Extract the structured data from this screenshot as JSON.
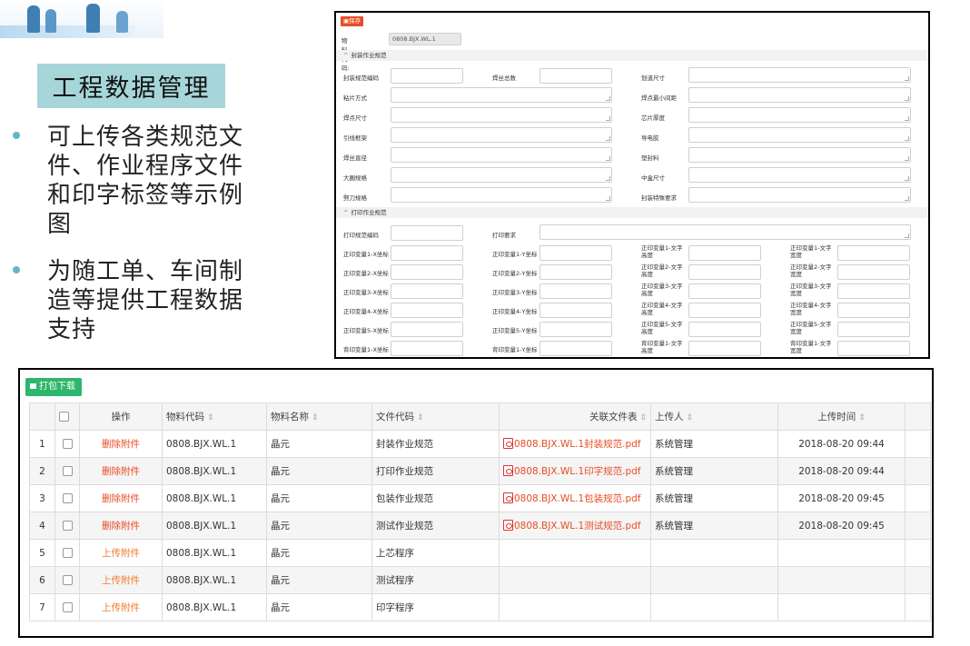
{
  "slide": {
    "title": "工程数据管理",
    "bullets": [
      "可上传各类规范文件、作业程序文件和印字标签等示例图",
      "为随工单、车间制造等提供工程数据支持"
    ]
  },
  "form": {
    "save_label": "保存",
    "material_code_label": "物料代码:",
    "material_code_value": "0808.BJX.WL.1",
    "sections": [
      {
        "title": "封装作业规范",
        "fields": [
          "封装规范编码",
          "焊丝总数",
          "划道尺寸",
          "粘片方式",
          "焊点最小间距",
          "焊点尺寸",
          "芯片厚度",
          "引线框架",
          "导电胶",
          "焊丝直径",
          "塑封料",
          "大圈规格",
          "中盒尺寸",
          "劈刀规格",
          "封装特殊要求"
        ]
      },
      {
        "title": "打印作业规范",
        "fields": [
          "打印规范编码",
          "打印要求",
          "正印变量1-X坐标",
          "正印变量1-Y坐标",
          "正印变量1-文字高度",
          "正印变量1-文字宽度",
          "正印变量2-X坐标",
          "正印变量2-Y坐标",
          "正印变量2-文字高度",
          "正印变量2-文字宽度",
          "正印变量3-X坐标",
          "正印变量3-Y坐标",
          "正印变量3-文字高度",
          "正印变量3-文字宽度",
          "正印变量4-X坐标",
          "正印变量4-Y坐标",
          "正印变量4-文字高度",
          "正印变量4-文字宽度",
          "正印变量5-X坐标",
          "正印变量5-Y坐标",
          "正印变量5-文字高度",
          "正印变量5-文字宽度",
          "背印变量1-X坐标",
          "背印变量1-Y坐标",
          "背印变量1-文字高度",
          "背印变量1-文字宽度"
        ]
      }
    ]
  },
  "table": {
    "pack_download_label": "打包下载",
    "columns": [
      "操作",
      "物料代码",
      "物料名称",
      "文件代码",
      "关联文件表",
      "上传人",
      "上传时间"
    ],
    "rows": [
      {
        "num": "1",
        "op": "删除附件",
        "code": "0808.BJX.WL.1",
        "name": "晶元",
        "file": "封装作业规范",
        "rel": "0808.BJX.WL.1封装规范.pdf",
        "uploader": "系统管理",
        "time": "2018-08-20 09:44"
      },
      {
        "num": "2",
        "op": "删除附件",
        "code": "0808.BJX.WL.1",
        "name": "晶元",
        "file": "打印作业规范",
        "rel": "0808.BJX.WL.1印字规范.pdf",
        "uploader": "系统管理",
        "time": "2018-08-20 09:44"
      },
      {
        "num": "3",
        "op": "删除附件",
        "code": "0808.BJX.WL.1",
        "name": "晶元",
        "file": "包装作业规范",
        "rel": "0808.BJX.WL.1包装规范.pdf",
        "uploader": "系统管理",
        "time": "2018-08-20 09:45"
      },
      {
        "num": "4",
        "op": "删除附件",
        "code": "0808.BJX.WL.1",
        "name": "晶元",
        "file": "测试作业规范",
        "rel": "0808.BJX.WL.1测试规范.pdf",
        "uploader": "系统管理",
        "time": "2018-08-20 09:45"
      },
      {
        "num": "5",
        "op": "上传附件",
        "code": "0808.BJX.WL.1",
        "name": "晶元",
        "file": "上芯程序",
        "rel": "",
        "uploader": "",
        "time": ""
      },
      {
        "num": "6",
        "op": "上传附件",
        "code": "0808.BJX.WL.1",
        "name": "晶元",
        "file": "测试程序",
        "rel": "",
        "uploader": "",
        "time": ""
      },
      {
        "num": "7",
        "op": "上传附件",
        "code": "0808.BJX.WL.1",
        "name": "晶元",
        "file": "印字程序",
        "rel": "",
        "uploader": "",
        "time": ""
      }
    ]
  },
  "colors": {
    "accent_red": "#e84c25",
    "accent_green": "#2db66c",
    "title_bg": "#a6d6da",
    "bullet_dot": "#63b7c4"
  }
}
